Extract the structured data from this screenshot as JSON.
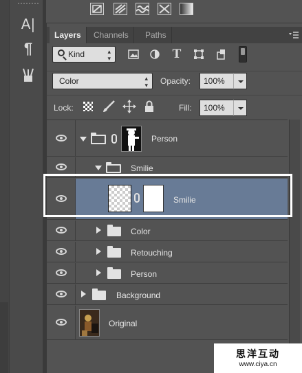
{
  "tools": {
    "items": [
      {
        "name": "character-panel-icon",
        "glyph": "A|"
      },
      {
        "name": "paragraph-panel-icon",
        "glyph": "¶"
      },
      {
        "name": "tool-presets-icon",
        "glyph": ""
      }
    ]
  },
  "top_icons": [
    "adjustment-icon",
    "gradient-icon",
    "pattern-icon",
    "crossed-icon",
    "fade-gradient-icon"
  ],
  "panel": {
    "tabs": [
      {
        "label": "Layers",
        "active": true
      },
      {
        "label": "Channels",
        "active": false
      },
      {
        "label": "Paths",
        "active": false
      }
    ],
    "menu_icon": "panel-menu-icon",
    "filter": {
      "kind_label": "Kind",
      "icons": [
        "pixel-filter-icon",
        "adjustment-filter-icon",
        "type-filter-icon",
        "shape-filter-icon",
        "smart-object-filter-icon"
      ]
    },
    "blend_mode": "Color",
    "opacity_label": "Opacity:",
    "opacity_value": "100%",
    "lock_label": "Lock:",
    "fill_label": "Fill:",
    "fill_value": "100%"
  },
  "layers": [
    {
      "name": "Person",
      "type": "group-mask",
      "expanded": true,
      "indent": 0
    },
    {
      "name": "Smilie",
      "type": "group",
      "expanded": true,
      "indent": 1
    },
    {
      "name": "Smilie",
      "type": "layer-mask",
      "selected": true,
      "indent": 2
    },
    {
      "name": "Color",
      "type": "group",
      "expanded": false,
      "indent": 1
    },
    {
      "name": "Retouching",
      "type": "group",
      "expanded": false,
      "indent": 1
    },
    {
      "name": "Person",
      "type": "group",
      "expanded": false,
      "indent": 1
    },
    {
      "name": "Background",
      "type": "group",
      "expanded": false,
      "indent": 0
    },
    {
      "name": "Original",
      "type": "image",
      "indent": 0
    }
  ],
  "watermark": {
    "chinese": "思洋互动",
    "url": "www.ciya.cn"
  },
  "colors": {
    "panel_bg": "#535353",
    "selection": "#687b96",
    "highlight_frame": "#ffffff"
  }
}
